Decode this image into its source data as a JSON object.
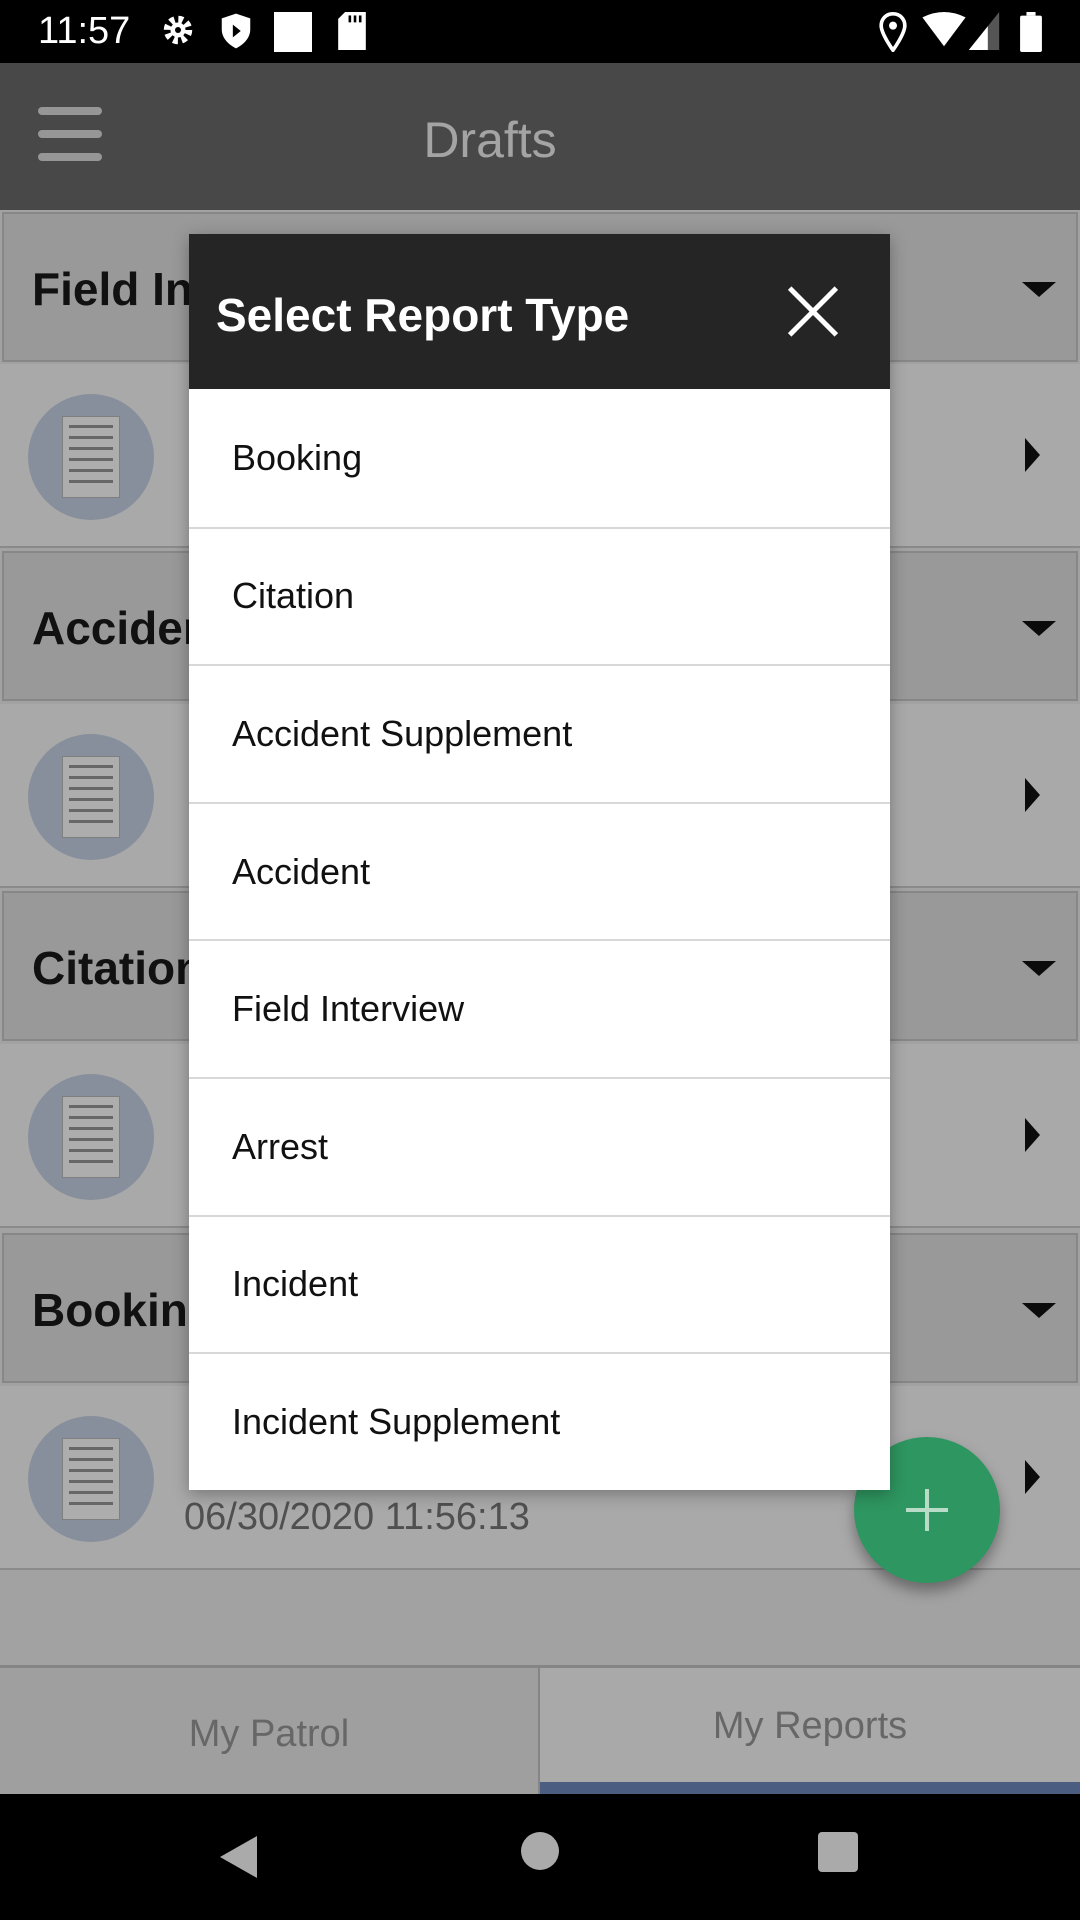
{
  "status_bar": {
    "time": "11:57",
    "left_icons": [
      "gear-icon",
      "shield-icon",
      "square-notification-icon",
      "sd-card-icon"
    ],
    "right_icons": [
      "location-icon",
      "wifi-icon",
      "signal-icon",
      "battery-icon"
    ]
  },
  "app_bar": {
    "title": "Drafts",
    "menu_icon": "hamburger-menu-icon"
  },
  "sections": [
    {
      "header": "Field Interview"
    },
    {
      "header": "Accident"
    },
    {
      "header": "Citation"
    },
    {
      "header": "Booking",
      "item_date": "06/30/2020 11:56:13"
    }
  ],
  "bottom_tabs": [
    {
      "label": "My Patrol",
      "selected": false
    },
    {
      "label": "My Reports",
      "selected": true
    }
  ],
  "fab": {
    "icon": "plus-icon",
    "color": "#2e9660"
  },
  "dialog": {
    "title": "Select Report Type",
    "options": [
      "Booking",
      "Citation",
      "Accident Supplement",
      "Accident",
      "Field Interview",
      "Arrest",
      "Incident",
      "Incident Supplement"
    ]
  },
  "colors": {
    "tab_indicator": "#6f8abf",
    "dialog_header": "#252525"
  }
}
